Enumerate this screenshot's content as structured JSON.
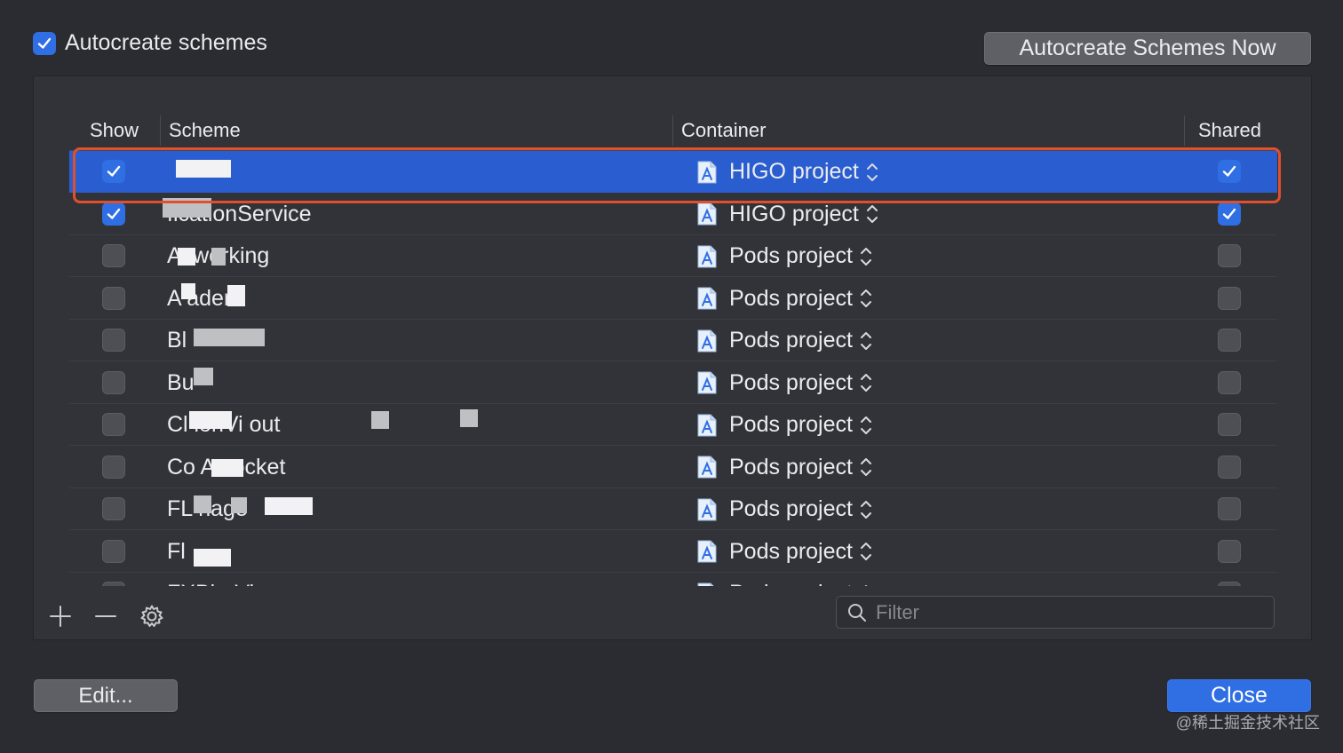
{
  "top": {
    "autocreate_label": "Autocreate schemes",
    "autocreate_checked": true,
    "autocreate_now_label": "Autocreate Schemes Now"
  },
  "table": {
    "headers": {
      "show": "Show",
      "scheme": "Scheme",
      "container": "Container",
      "shared": "Shared"
    },
    "rows": [
      {
        "scheme": "",
        "container": "HIGO project",
        "show": true,
        "shared": true,
        "selected": true
      },
      {
        "scheme": "ficationService",
        "container": "HIGO project",
        "show": true,
        "shared": true
      },
      {
        "scheme": "A  tworking",
        "container": "Pods project",
        "show": false,
        "shared": false
      },
      {
        "scheme": "A              ader",
        "container": "Pods project",
        "show": false,
        "shared": false
      },
      {
        "scheme": "Bl",
        "container": "Pods project",
        "show": false,
        "shared": false
      },
      {
        "scheme": "Bu",
        "container": "Pods project",
        "show": false,
        "shared": false
      },
      {
        "scheme": "Cl           ionVi                        out",
        "container": "Pods project",
        "show": false,
        "shared": false
      },
      {
        "scheme": "Co      As    ocket",
        "container": "Pods project",
        "show": false,
        "shared": false
      },
      {
        "scheme": "FL              nage",
        "container": "Pods project",
        "show": false,
        "shared": false
      },
      {
        "scheme": "Fl",
        "container": "Pods project",
        "show": false,
        "shared": false
      },
      {
        "scheme": "FXBlurView",
        "container": "Pods project",
        "show": false,
        "shared": false
      }
    ]
  },
  "filter": {
    "placeholder": "Filter"
  },
  "footer": {
    "edit_label": "Edit...",
    "close_label": "Close"
  },
  "watermark": "@稀土掘金技术社区",
  "colors": {
    "accent": "#2f6fe3",
    "selection": "#2a5dd0",
    "highlight_border": "#e0502a"
  },
  "icons": [
    "plus-icon",
    "minus-icon",
    "gear-icon",
    "search-icon",
    "xcode-project-icon",
    "updown-chevron-icon",
    "checkmark-icon"
  ]
}
